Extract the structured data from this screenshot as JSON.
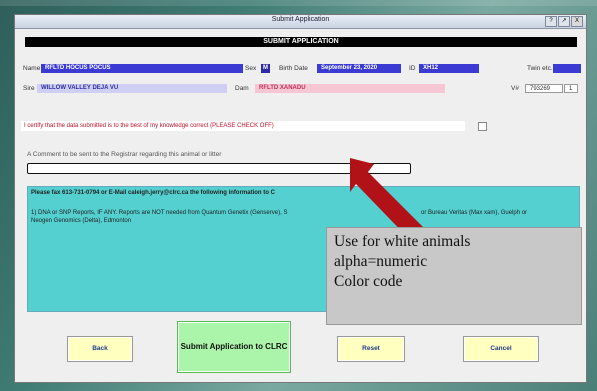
{
  "window": {
    "title": "Submit Application",
    "controls": [
      "?",
      "↗",
      "X"
    ]
  },
  "header": {
    "title": "SUBMIT APPLICATION"
  },
  "animal": {
    "name_label": "Name",
    "name_value": "RFLTD HOCUS POCUS",
    "sex_label": "Sex",
    "sex_value": "M",
    "birth_date_label": "Birth Date",
    "birth_date_value": "September 23, 2020",
    "id_label": "ID",
    "id_value": "XH12",
    "twin_label": "Twin etc.",
    "twin_value": ""
  },
  "parents": {
    "sire_label": "Sire",
    "sire_value": "WILLOW VALLEY DEJA VU",
    "dam_label": "Dam",
    "dam_value": "RFLTD XANADU",
    "v_label": "V#",
    "v_value": "793269",
    "v_extra": "1"
  },
  "certify": {
    "text": "I certify that the data submitted is to the best of my knowledge correct (PLEASE CHECK OFF)",
    "checked": false
  },
  "comment": {
    "label": "A Comment to be sent to the Registrar regarding this animal or litter",
    "value": ""
  },
  "info": {
    "line1_start": "Please fax 613-731-0794 or E-Mail caleigh.jerry@clrc.ca the following information to C",
    "line2_start": "1) DNA or SNP Reports, IF ANY.  Reports are NOT needed from Quantum Genetix (Genserve), S",
    "line2_end": "or Bureau Veritas (Max xam), Guelph or",
    "line3": "Neogen Genomics (Delta), Edmonton"
  },
  "buttons": {
    "back": "Back",
    "submit": "Submit Application to CLRC",
    "reset": "Reset",
    "cancel": "Cancel"
  },
  "callout": {
    "line1": "Use for white animals",
    "line2": "alpha=numeric",
    "line3": "Color code"
  },
  "colors": {
    "arrow": "#b01218",
    "info_panel": "#55d0d0",
    "submit_button": "#aaf5aa",
    "action_button": "#ffffc0"
  }
}
